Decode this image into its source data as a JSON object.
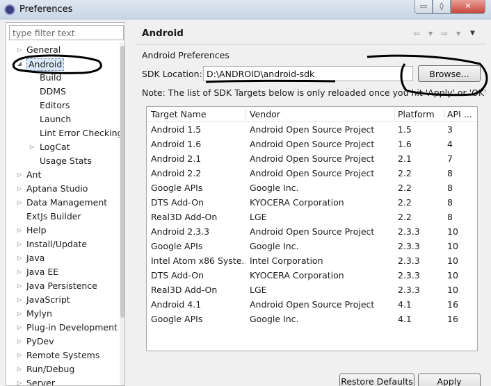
{
  "window": {
    "title": "Preferences",
    "controls": {
      "minimize": "▭",
      "maximize": "◊",
      "close": "✕"
    }
  },
  "filter": {
    "placeholder": "type filter text",
    "value": ""
  },
  "tree": [
    {
      "label": "General",
      "arrow": "▷",
      "selected": false
    },
    {
      "label": "Android",
      "arrow": "◢",
      "selected": true
    },
    {
      "label": "Build",
      "arrow": "",
      "selected": false
    },
    {
      "label": "DDMS",
      "arrow": "",
      "selected": false
    },
    {
      "label": "Editors",
      "arrow": "",
      "selected": false
    },
    {
      "label": "Launch",
      "arrow": "",
      "selected": false
    },
    {
      "label": "Lint Error Checking",
      "arrow": "",
      "selected": false
    },
    {
      "label": "LogCat",
      "arrow": "▷",
      "selected": false
    },
    {
      "label": "Usage Stats",
      "arrow": "",
      "selected": false
    },
    {
      "label": "Ant",
      "arrow": "▷",
      "selected": false
    },
    {
      "label": "Aptana Studio",
      "arrow": "▷",
      "selected": false
    },
    {
      "label": "Data Management",
      "arrow": "▷",
      "selected": false
    },
    {
      "label": "ExtJs Builder",
      "arrow": "",
      "selected": false
    },
    {
      "label": "Help",
      "arrow": "▷",
      "selected": false
    },
    {
      "label": "Install/Update",
      "arrow": "▷",
      "selected": false
    },
    {
      "label": "Java",
      "arrow": "▷",
      "selected": false
    },
    {
      "label": "Java EE",
      "arrow": "▷",
      "selected": false
    },
    {
      "label": "Java Persistence",
      "arrow": "▷",
      "selected": false
    },
    {
      "label": "JavaScript",
      "arrow": "▷",
      "selected": false
    },
    {
      "label": "Mylyn",
      "arrow": "▷",
      "selected": false
    },
    {
      "label": "Plug-in Development",
      "arrow": "▷",
      "selected": false
    },
    {
      "label": "PyDev",
      "arrow": "▷",
      "selected": false
    },
    {
      "label": "Remote Systems",
      "arrow": "▷",
      "selected": false
    },
    {
      "label": "Run/Debug",
      "arrow": "▷",
      "selected": false
    },
    {
      "label": "Server",
      "arrow": "▷",
      "selected": false
    }
  ],
  "page": {
    "title": "Android",
    "nav_back": "⇦",
    "nav_forward": "⇨",
    "nav_menu": "▼",
    "heading": "Android Preferences",
    "sdk_label": "SDK Location:",
    "sdk_value": "D:\\ANDROID\\android-sdk",
    "browse_label": "Browse...",
    "note": "Note: The list of SDK Targets below is only reloaded once you hit 'Apply' or 'OK'."
  },
  "table": {
    "headers": [
      "Target Name",
      "Vendor",
      "Platform",
      "API ..."
    ],
    "rows": [
      [
        "Android 1.5",
        "Android Open Source Project",
        "1.5",
        "3"
      ],
      [
        "Android 1.6",
        "Android Open Source Project",
        "1.6",
        "4"
      ],
      [
        "Android 2.1",
        "Android Open Source Project",
        "2.1",
        "7"
      ],
      [
        "Android 2.2",
        "Android Open Source Project",
        "2.2",
        "8"
      ],
      [
        "Google APIs",
        "Google Inc.",
        "2.2",
        "8"
      ],
      [
        "DTS Add-On",
        "KYOCERA Corporation",
        "2.2",
        "8"
      ],
      [
        "Real3D Add-On",
        "LGE",
        "2.2",
        "8"
      ],
      [
        "Android 2.3.3",
        "Android Open Source Project",
        "2.3.3",
        "10"
      ],
      [
        "Google APIs",
        "Google Inc.",
        "2.3.3",
        "10"
      ],
      [
        "Intel Atom x86 Syste...",
        "Intel Corporation",
        "2.3.3",
        "10"
      ],
      [
        "DTS Add-On",
        "KYOCERA Corporation",
        "2.3.3",
        "10"
      ],
      [
        "Real3D Add-On",
        "LGE",
        "2.3.3",
        "10"
      ],
      [
        "Android 4.1",
        "Android Open Source Project",
        "4.1",
        "16"
      ],
      [
        "Google APIs",
        "Google Inc.",
        "4.1",
        "16"
      ]
    ]
  },
  "buttons": {
    "restore": "Restore Defaults",
    "apply": "Apply"
  }
}
